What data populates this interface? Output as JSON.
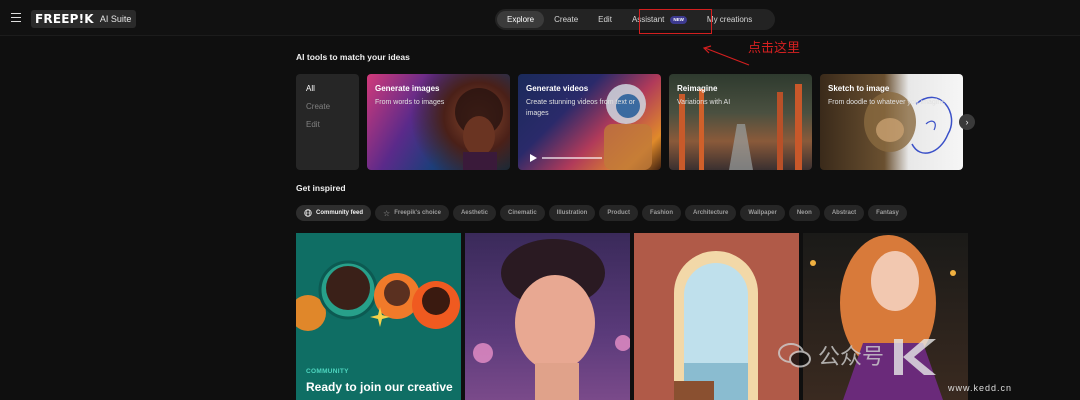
{
  "header": {
    "logo_word": "FREEP!K",
    "logo_suite": "AI Suite",
    "nav": [
      {
        "label": "Explore",
        "active": true
      },
      {
        "label": "Create",
        "active": false
      },
      {
        "label": "Edit",
        "active": false
      },
      {
        "label": "Assistant",
        "active": false,
        "badge": "NEW"
      },
      {
        "label": "My creations",
        "active": false
      }
    ]
  },
  "annotation": {
    "text": "点击这里",
    "color": "#d52020"
  },
  "tools": {
    "heading": "AI tools to match your ideas",
    "categories": [
      {
        "label": "All",
        "active": true
      },
      {
        "label": "Create",
        "active": false
      },
      {
        "label": "Edit",
        "active": false
      }
    ],
    "cards": [
      {
        "title": "Generate images",
        "subtitle": "From words to images"
      },
      {
        "title": "Generate videos",
        "subtitle": "Create stunning videos from text or images"
      },
      {
        "title": "Reimagine",
        "subtitle": "Variations with AI"
      },
      {
        "title": "Sketch to image",
        "subtitle": "From doodle to whatever you imagine"
      }
    ],
    "next_icon": "chevron-right-icon"
  },
  "inspired": {
    "heading": "Get inspired",
    "filters": [
      {
        "label": "Community feed",
        "icon": "globe-icon",
        "active": true
      },
      {
        "label": "Freepik's choice",
        "icon": "star-icon",
        "active": false
      },
      {
        "label": "Aesthetic"
      },
      {
        "label": "Cinematic"
      },
      {
        "label": "Illustration"
      },
      {
        "label": "Product"
      },
      {
        "label": "Fashion"
      },
      {
        "label": "Architecture"
      },
      {
        "label": "Wallpaper"
      },
      {
        "label": "Neon"
      },
      {
        "label": "Abstract"
      },
      {
        "label": "Fantasy"
      }
    ],
    "community_label": "COMMUNITY",
    "community_text": "Ready to join our creative"
  },
  "watermark": {
    "text": "公众号",
    "url": "www.kedd.cn"
  }
}
